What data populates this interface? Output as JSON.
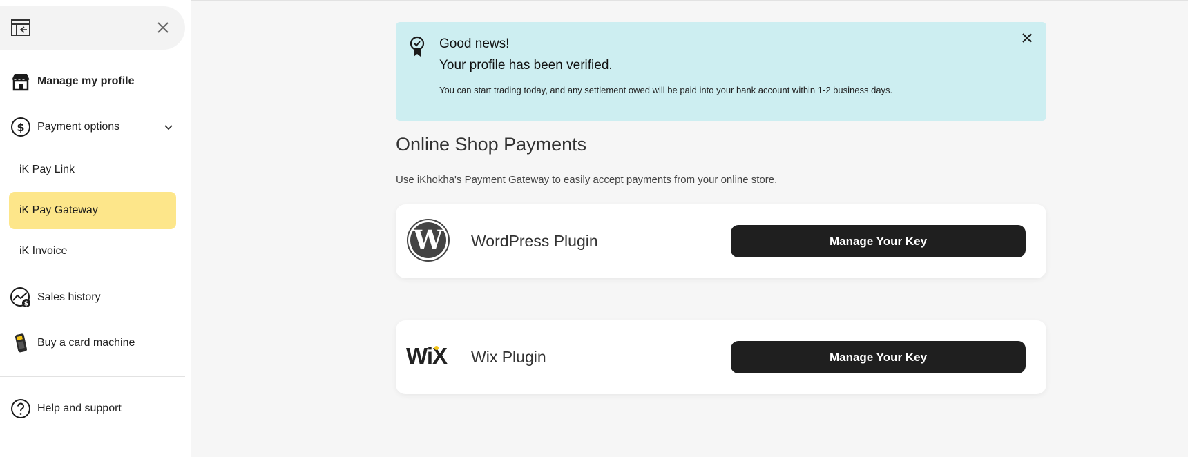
{
  "sidebar": {
    "nav": {
      "manage_profile": "Manage my profile",
      "payment_options": "Payment options",
      "sales_history": "Sales history",
      "buy_card_machine": "Buy a card machine",
      "help_support": "Help and support"
    },
    "sub_items": {
      "pay_link": "iK Pay Link",
      "pay_gateway": "iK Pay Gateway",
      "invoice": "iK Invoice"
    },
    "active_item": "iK Pay Gateway"
  },
  "banner": {
    "title": "Good news!",
    "subtitle": "Your profile has been verified.",
    "text": "You can start trading today, and any settlement owed will be paid into your bank account within 1-2 business days."
  },
  "main": {
    "title": "Online Shop Payments",
    "description": "Use iKhokha's Payment Gateway to easily accept payments from your online store.",
    "plugins": [
      {
        "name": "WordPress Plugin",
        "button": "Manage Your Key",
        "icon": "wordpress-logo"
      },
      {
        "name": "Wix Plugin",
        "button": "Manage Your Key",
        "icon": "wix-logo"
      }
    ]
  },
  "colors": {
    "banner_bg": "#cdeef1",
    "active_bg": "#fde68a",
    "button_bg": "#1f1f1f",
    "page_bg": "#f6f6f6"
  }
}
